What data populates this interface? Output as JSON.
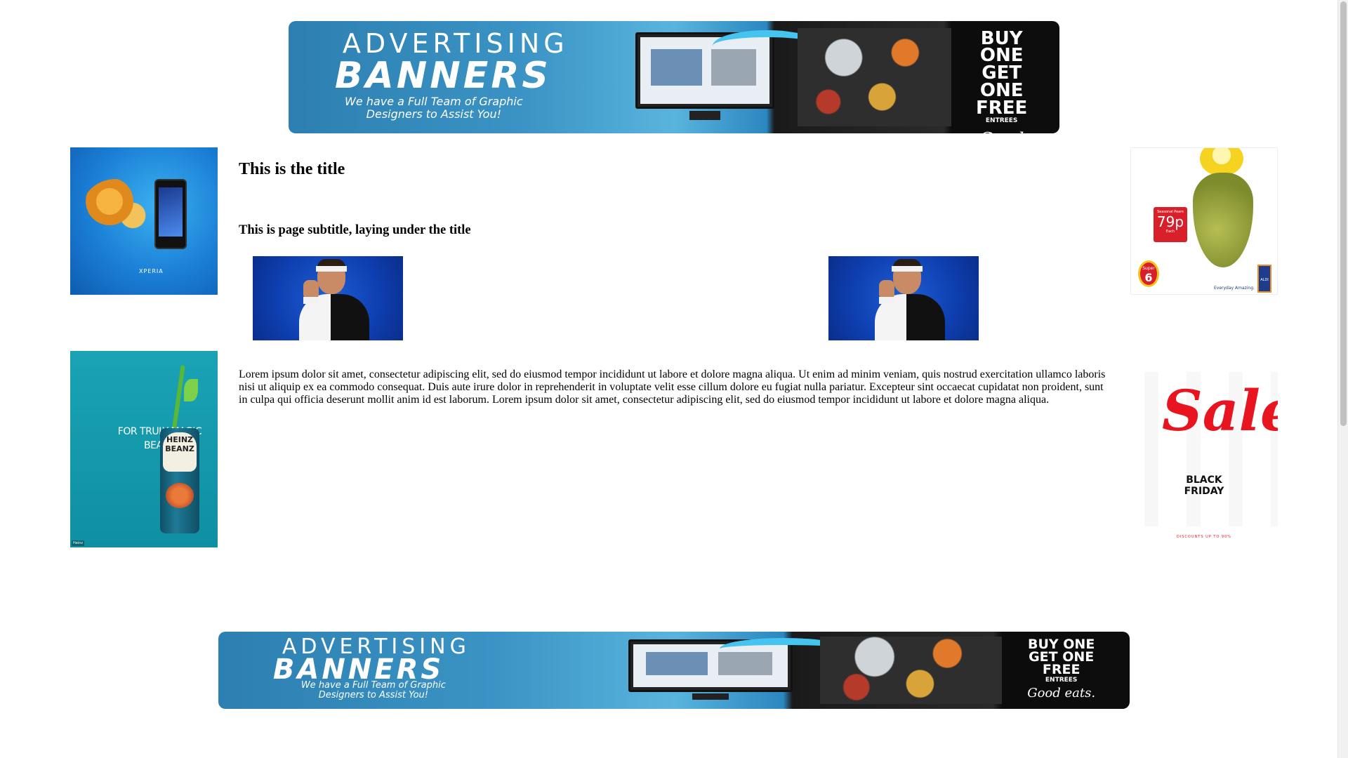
{
  "page": {
    "title": "This is the title",
    "subtitle": "This is page subtitle, laying under the title",
    "body_text": "Lorem ipsum dolor sit amet, consectetur adipiscing elit, sed do eiusmod tempor incididunt ut labore et dolore magna aliqua. Ut enim ad minim veniam, quis nostrud exercitation ullamco laboris nisi ut aliquip ex ea commodo consequat. Duis aute irure dolor in reprehenderit in voluptate velit esse cillum dolore eu fugiat nulla pariatur. Excepteur sint occaecat cupidatat non proident, sunt in culpa qui officia deserunt mollit anim id est laborum. Lorem ipsum dolor sit amet, consectetur adipiscing elit, sed do eiusmod tempor incididunt ut labore et dolore magna aliqua."
  },
  "banner": {
    "line1": "ADVERTISING",
    "line2": "BANNERS",
    "tagline": "We have a Full Team of Graphic Designers to Assist You!",
    "offer_big": "BUY ONE GET ONE FREE",
    "offer_small": "ENTREES",
    "offer_script": "Good eats."
  },
  "ads": {
    "phone": {
      "brand": "XPERIA"
    },
    "pear": {
      "tag_top": "Seasonal Pears",
      "price": "79p",
      "tag_bottom": "Each",
      "super": "Super",
      "super_num": "6",
      "slogan": "Everyday Amazing.",
      "logo": "ALDI"
    },
    "beans": {
      "copy": "FOR TRULY MAGIC BEANS",
      "can_label": "HEINZ BEANZ",
      "credit": "Heinz"
    },
    "sale": {
      "script": "Sale",
      "subline": "BLACK FRIDAY",
      "discount": "DISCOUNTS UP TO 90%"
    }
  },
  "colors": {
    "banner_blue": "#2d7fb1",
    "sale_red": "#e8141f",
    "beans_teal": "#1aa3b5",
    "phone_blue": "#1b7fd6"
  }
}
